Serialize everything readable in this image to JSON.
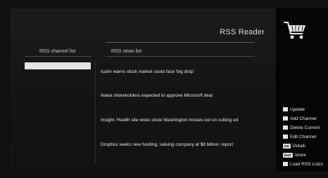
{
  "header": {
    "title": "RSS Reader",
    "cart_icon": "shopping-cart-icon"
  },
  "columns": {
    "channel_header": "RSS channel list",
    "news_header": "RSS news list"
  },
  "channels": [
    {
      "label": "",
      "selected": true
    }
  ],
  "news": [
    "Icahn warns stock market could face 'big drop'",
    "Nokia shareholders expected to approve Microsoft deal",
    "Insight: Health site woes show Washington misses out on cutting ed",
    "Dropbox seeks new funding, valuing company at $8 billion: report"
  ],
  "menu": [
    {
      "label": "Update",
      "icon": "white-square-icon"
    },
    {
      "label": "Add Channel",
      "icon": "white-square-icon"
    },
    {
      "label": "Delete Current",
      "icon": "white-square-icon"
    },
    {
      "label": "Edit Channel",
      "icon": "white-square-icon"
    },
    {
      "label": "Detalii",
      "key": "OK"
    },
    {
      "label": "Iesire",
      "key": "EXIT"
    },
    {
      "label": "Load RSS List(s",
      "icon": "white-square-icon"
    }
  ],
  "colors": {
    "background": "#101010",
    "panel": "#1b1b1b",
    "sidebar": "#050505",
    "text": "#e6e6e6",
    "selection": "#e4e4e4"
  }
}
